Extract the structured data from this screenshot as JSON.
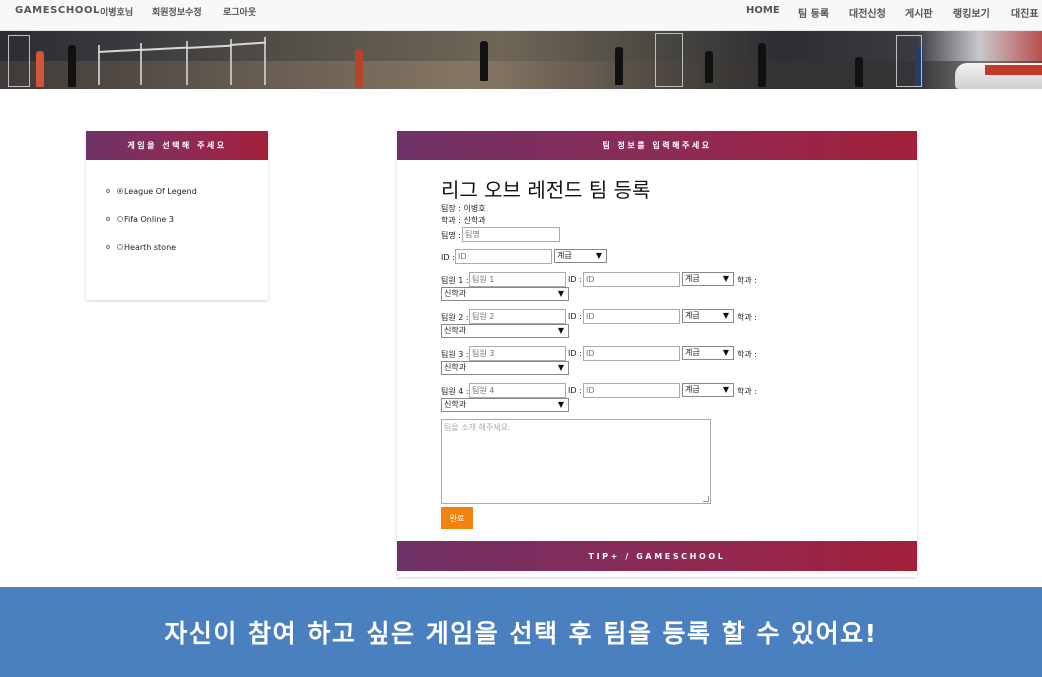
{
  "nav": {
    "brand": "GAMESCHOOL",
    "left_links": [
      "이병호님",
      "회원정보수정",
      "로그아웃"
    ],
    "right_links": [
      "HOME",
      "팀 등록",
      "대전신청",
      "게시판",
      "랭킹보기",
      "대진표"
    ]
  },
  "game_panel": {
    "title": "게임을 선택해 주세요",
    "games": [
      {
        "label": "League Of Legend",
        "selected": true
      },
      {
        "label": "Fifa Online 3",
        "selected": false
      },
      {
        "label": "Hearth stone",
        "selected": false
      }
    ]
  },
  "form_panel": {
    "header": "팀 정보를 입력해주세요",
    "title": "리그 오브 레전드 팀 등록",
    "leader_line": "팀장 : 이병호",
    "major_line": "학과 : 신학과",
    "team_name_label": "팀명 :",
    "team_name_placeholder": "팀명",
    "id_label": "ID :",
    "id_placeholder": "ID",
    "tier_value": "계급",
    "major_label": "학과 :",
    "major_value": "신학과",
    "members": [
      {
        "label": "팀원 1 :",
        "placeholder": "팀원 1"
      },
      {
        "label": "팀원 2 :",
        "placeholder": "팀원 2"
      },
      {
        "label": "팀원 3 :",
        "placeholder": "팀원 3"
      },
      {
        "label": "팀원 4 :",
        "placeholder": "팀원 4"
      }
    ],
    "intro_placeholder": "팀을 소개 해주세요.",
    "submit_label": "완료",
    "footer": "TIP+ / GAMESCHOOL"
  },
  "caption": "자신이 참여 하고 싶은 게임을 선택 후 팀을 등록 할 수 있어요!"
}
